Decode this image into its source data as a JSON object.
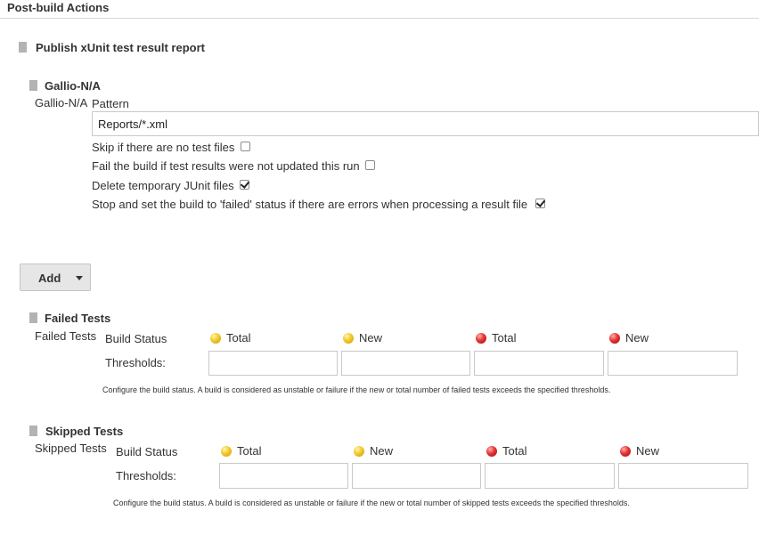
{
  "section": {
    "title": "Post-build Actions"
  },
  "publisher": {
    "title": "Publish xUnit test result report"
  },
  "tool": {
    "title": "Gallio-N/A",
    "side_label": "Gallio-N/A",
    "pattern_label": "Pattern",
    "pattern_value": "Reports/*.xml",
    "options": [
      {
        "label": "Skip if there are no test files",
        "checked": false
      },
      {
        "label": "Fail the build if test results were not updated this run",
        "checked": false
      },
      {
        "label": "Delete temporary JUnit files",
        "checked": true
      },
      {
        "label": "Stop and set the build to 'failed' status if there are errors when processing a result file",
        "checked": true
      }
    ]
  },
  "add_button": {
    "label": "Add"
  },
  "failed": {
    "title": "Failed Tests",
    "side_label": "Failed Tests",
    "build_status_label": "Build Status",
    "thresholds_label": "Thresholds:",
    "columns": [
      {
        "label": "Total",
        "color": "yellow"
      },
      {
        "label": "New",
        "color": "yellow"
      },
      {
        "label": "Total",
        "color": "red"
      },
      {
        "label": "New",
        "color": "red"
      }
    ],
    "values": [
      "",
      "",
      "",
      ""
    ],
    "hint": "Configure the build status. A build is considered as unstable or failure if the new or total number of failed tests exceeds the specified thresholds."
  },
  "skipped": {
    "title": "Skipped Tests",
    "side_label": "Skipped Tests",
    "build_status_label": "Build Status",
    "thresholds_label": "Thresholds:",
    "columns": [
      {
        "label": "Total",
        "color": "yellow"
      },
      {
        "label": "New",
        "color": "yellow"
      },
      {
        "label": "Total",
        "color": "red"
      },
      {
        "label": "New",
        "color": "red"
      }
    ],
    "values": [
      "",
      "",
      "",
      ""
    ],
    "hint": "Configure the build status. A build is considered as unstable or failure if the new or total number of skipped tests exceeds the specified thresholds."
  },
  "colors": {
    "yellow_ball": "#f3c82a",
    "red_ball": "#e53333",
    "button_bg": "#e6e6e6"
  }
}
